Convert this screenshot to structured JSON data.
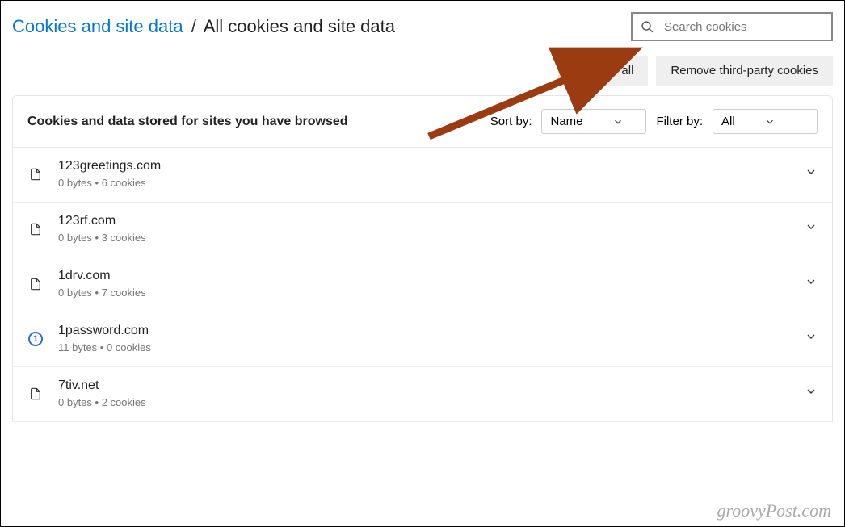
{
  "breadcrumb": {
    "parent": "Cookies and site data",
    "current": "All cookies and site data"
  },
  "search": {
    "placeholder": "Search cookies"
  },
  "actions": {
    "remove_all": "Remove all",
    "remove_third_party": "Remove third-party cookies"
  },
  "panel": {
    "title": "Cookies and data stored for sites you have browsed",
    "sort_label": "Sort by:",
    "sort_value": "Name",
    "filter_label": "Filter by:",
    "filter_value": "All"
  },
  "rows": [
    {
      "domain": "123greetings.com",
      "meta": "0 bytes • 6 cookies",
      "icon": "file"
    },
    {
      "domain": "123rf.com",
      "meta": "0 bytes • 3 cookies",
      "icon": "file"
    },
    {
      "domain": "1drv.com",
      "meta": "0 bytes • 7 cookies",
      "icon": "file"
    },
    {
      "domain": "1password.com",
      "meta": "11 bytes • 0 cookies",
      "icon": "onepw"
    },
    {
      "domain": "7tiv.net",
      "meta": "0 bytes • 2 cookies",
      "icon": "file"
    }
  ],
  "watermark": "groovyPost.com"
}
